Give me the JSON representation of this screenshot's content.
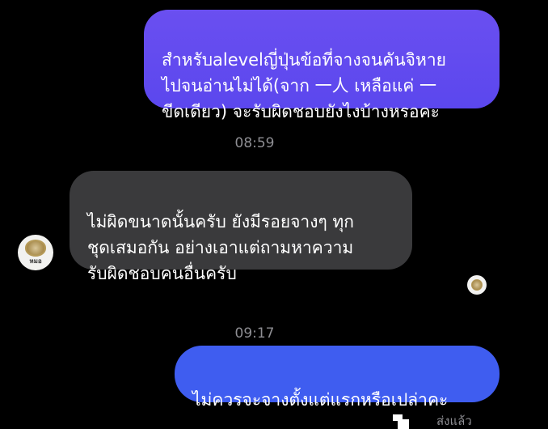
{
  "messages": {
    "outgoing_1": "สำหรับalevelญี่ปุ่นข้อที่จางจนคันจิหาย\nไปจนอ่านไม่ได้(จาก 一人 เหลือแค่ 一\nขีดเดียว) จะรับผิดชอบยังไงบ้างหรอคะ",
    "incoming_1": "ไม่ผิดขนาดนั้นครับ ยังมีรอยจางๆ ทุก\nชุดเสมอกัน อย่างเอาแต่ถามหาความ\nรับผิดชอบคนอื่นครับ",
    "outgoing_2": "ไม่ควรจะจางตั้งแต่แรกหรือเปล่าคะ"
  },
  "timestamps": {
    "first": "08:59",
    "second": "09:17"
  },
  "contact": {
    "avatar_tag": "หมอ"
  },
  "status": {
    "sent": "ส่งแล้ว"
  },
  "colors": {
    "background": "#000000",
    "outgoing_bubble": "#5b47ee",
    "outgoing_bubble_latest": "#3f5df0",
    "incoming_bubble": "#3a3a3c",
    "timestamp_text": "#8e8e93"
  }
}
